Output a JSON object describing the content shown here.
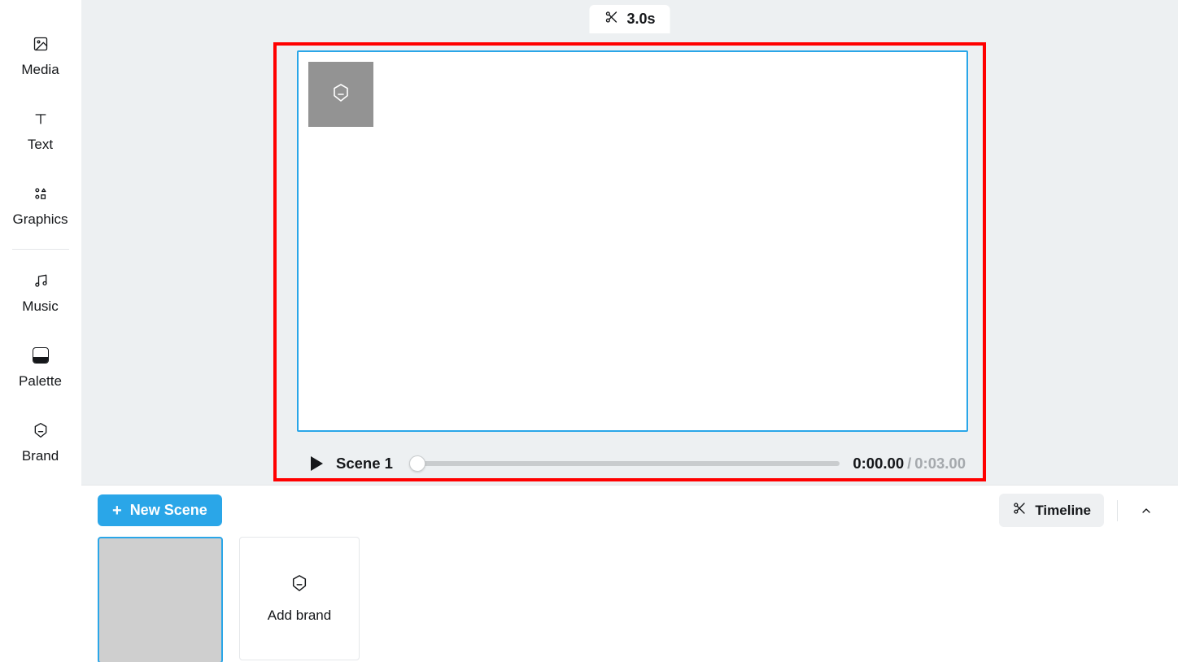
{
  "sidebar": {
    "items": [
      {
        "label": "Media"
      },
      {
        "label": "Text"
      },
      {
        "label": "Graphics"
      },
      {
        "label": "Music"
      },
      {
        "label": "Palette"
      },
      {
        "label": "Brand"
      }
    ]
  },
  "trim": {
    "duration": "3.0s"
  },
  "playbar": {
    "scene_label": "Scene 1",
    "current_time": "0:00.00",
    "separator": "/",
    "total_time": "0:03.00"
  },
  "bottom": {
    "new_scene_label": "New Scene",
    "timeline_label": "Timeline",
    "add_brand_label": "Add brand"
  }
}
